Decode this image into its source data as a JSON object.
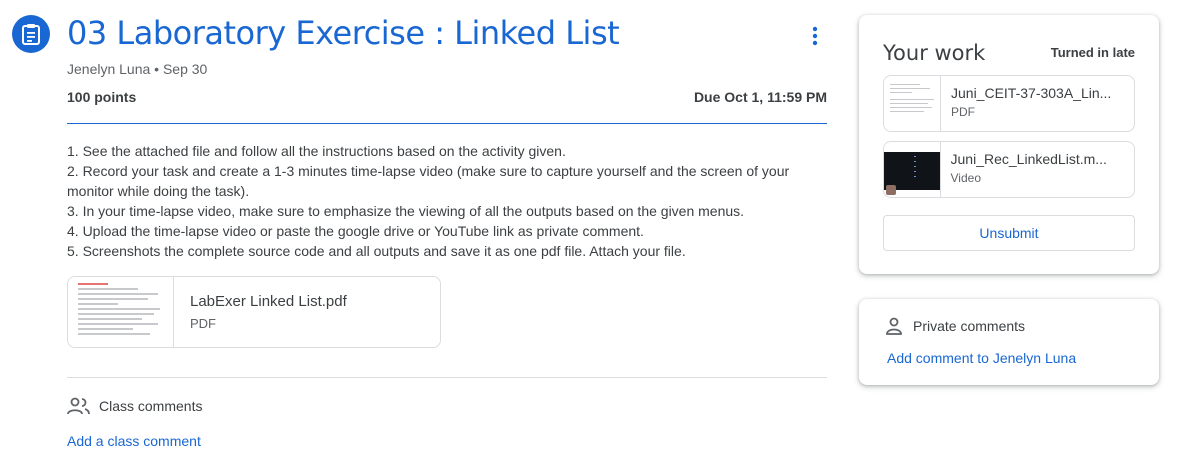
{
  "assignment": {
    "title": "03 Laboratory Exercise : Linked List",
    "byline": "Jenelyn Luna • Sep 30",
    "points": "100 points",
    "due": "Due Oct 1, 11:59 PM",
    "instructions": [
      "1. See the attached file and follow all the instructions based on the activity given.",
      "2. Record your task and create a 1-3 minutes time-lapse video (make sure to capture yourself and the screen of your monitor while doing the task).",
      "3. In your time-lapse video, make sure to emphasize the viewing of all the outputs based on the given menus.",
      "4. Upload the time-lapse video or paste the google drive or YouTube link as private comment.",
      "5. Screenshots the complete source code and all outputs and save it as one pdf file. Attach your file."
    ],
    "attachment": {
      "name": "LabExer Linked List.pdf",
      "type": "PDF"
    }
  },
  "class_comments": {
    "label": "Class comments",
    "add": "Add a class comment"
  },
  "your_work": {
    "title": "Your work",
    "status": "Turned in late",
    "files": [
      {
        "name": "Juni_CEIT-37-303A_Lin...",
        "type": "PDF"
      },
      {
        "name": "Juni_Rec_LinkedList.m...",
        "type": "Video"
      }
    ],
    "unsubmit": "Unsubmit"
  },
  "private_comments": {
    "label": "Private comments",
    "add": "Add comment to Jenelyn Luna"
  },
  "colors": {
    "accent": "#1967d2",
    "text": "#3c4043",
    "muted": "#5f6368",
    "border": "#dadce0"
  },
  "icons": {
    "assignment": "assignment-icon",
    "more": "more-vert-icon",
    "class_comments": "people-icon",
    "private_comments": "person-icon"
  }
}
